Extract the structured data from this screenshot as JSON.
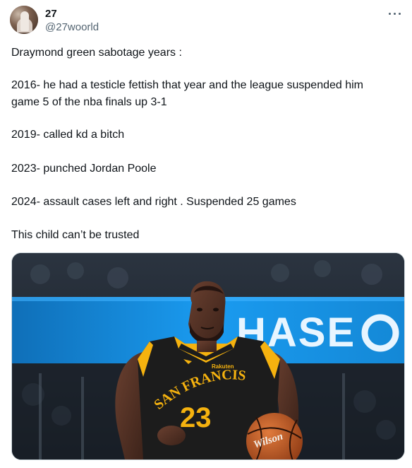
{
  "tweet": {
    "author": {
      "display_name": "27",
      "handle": "@27woorld",
      "avatar_icon": "avatar-photo"
    },
    "more_icon": "more-options-icon",
    "text_lines": [
      "Draymond green sabotage years :",
      "2016- he had a testicle fettish that year and the league suspended him",
      "game 5 of the nba finals up 3-1",
      "2019- called kd a bitch",
      "2023- punched Jordan Poole",
      "2024- assault cases left and right . Suspended 25 games",
      "This child can’t be trusted"
    ],
    "media": {
      "banner_text": "HASE",
      "jersey_sponsor": "Rakuten",
      "jersey_city": "SAN FRANCISCO",
      "jersey_number": "23",
      "ball_brand": "Wilson",
      "colors": {
        "banner": "#1a9bf0",
        "jersey": "#1c1c1c",
        "jersey_trim": "#f5b20f",
        "ball": "#c45a26"
      }
    }
  }
}
